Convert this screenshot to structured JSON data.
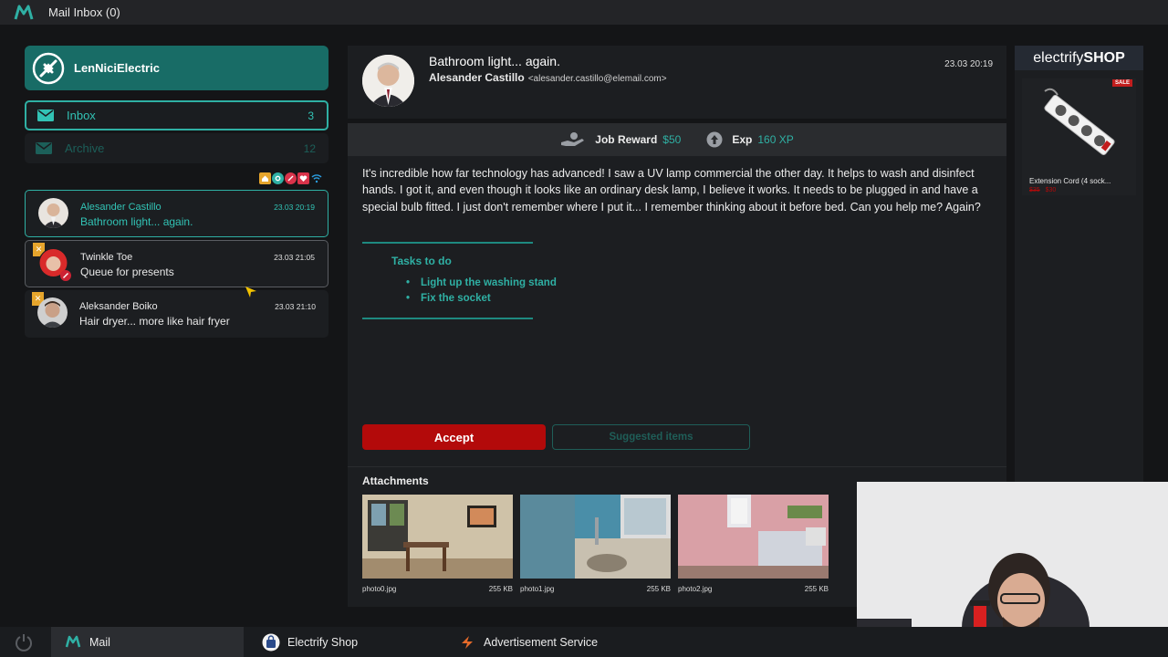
{
  "app": {
    "title": "Mail Inbox (0)"
  },
  "brand": {
    "name": "LenNiciElectric"
  },
  "folders": [
    {
      "label": "Inbox",
      "count": "3"
    },
    {
      "label": "Archive",
      "count": "12"
    }
  ],
  "mails": [
    {
      "sender": "Alesander Castillo",
      "subject": "Bathroom light... again.",
      "date": "23.03 20:19"
    },
    {
      "sender": "Twinkle Toe",
      "subject": "Queue for presents",
      "date": "23.03 21:05"
    },
    {
      "sender": "Aleksander Boiko",
      "subject": "Hair dryer... more like hair fryer",
      "date": "23.03 21:10"
    }
  ],
  "open_mail": {
    "title": "Bathroom light... again.",
    "from_name": "Alesander Castillo",
    "from_email": "<alesander.castillo@elemail.com>",
    "date": "23.03 20:19",
    "reward_label": "Job Reward",
    "reward_value": "$50",
    "exp_label": "Exp",
    "exp_value": "160 XP",
    "body": "It's incredible how far technology has advanced! I saw a UV lamp commercial the other day. It helps to wash and disinfect hands. I got it, and even though it looks like an ordinary desk lamp, I believe it works. It needs to be plugged in and have a special bulb fitted. I just don't remember where I put it... I remember thinking about it before bed. Can you help me? Again?",
    "tasks_title": "Tasks to do",
    "tasks": [
      "Light up the washing stand",
      "Fix the socket"
    ],
    "accept_label": "Accept",
    "suggested_label": "Suggested items",
    "attachments_title": "Attachments",
    "attachments": [
      {
        "name": "photo0.jpg",
        "size": "255 KB"
      },
      {
        "name": "photo1.jpg",
        "size": "255 KB"
      },
      {
        "name": "photo2.jpg",
        "size": "255 KB"
      }
    ]
  },
  "shop": {
    "logo_light": "electrify",
    "logo_bold": "SHOP",
    "sale_badge": "SALE",
    "product_name": "Extension Cord (4 sock...",
    "old_price": "$35",
    "new_price": "$30"
  },
  "taskbar": {
    "mail": "Mail",
    "shop": "Electrify Shop",
    "ads": "Advertisement Service"
  },
  "colors": {
    "accent": "#2fb0a4",
    "brand": "#186c66",
    "accept": "#b30a0a",
    "background": "#141517"
  }
}
